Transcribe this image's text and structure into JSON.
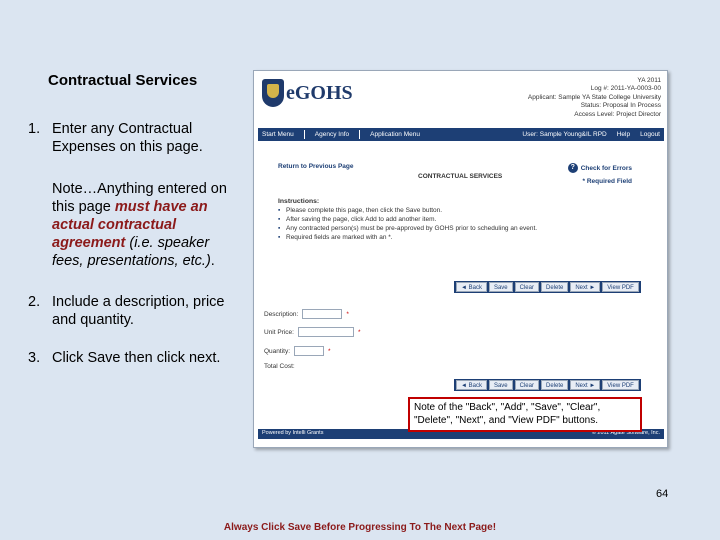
{
  "title": "Contractual Services",
  "steps": [
    {
      "num": "1.",
      "text": "Enter any Contractual Expenses on this page."
    },
    {
      "num": "2.",
      "text": "Include a description, price and quantity."
    },
    {
      "num": "3.",
      "text": "Click Save then click next."
    }
  ],
  "note": {
    "prefix": "Note…Anything entered on this page ",
    "emphasis": "must have an actual contractual agreement",
    "suffix_italic": " (i.e. speaker fees, presentations, etc.)",
    "end": "."
  },
  "screenshot": {
    "logo": "eGOHS",
    "user_info": [
      "YA 2011",
      "Log #: 2011-YA-0003-00",
      "Applicant: Sample YA State College University",
      "Status: Proposal In Process",
      "Access Level: Project Director"
    ],
    "nav": {
      "start_menu": "Start Menu",
      "agency_info": "Agency Info",
      "application_menu": "Application Menu",
      "user": "User: Sample Young&IL RPD",
      "help": "Help",
      "logout": "Logout"
    },
    "back_link": "Return to Previous Page",
    "page_heading": "CONTRACTUAL SERVICES",
    "check_errors": "Check for Errors",
    "required_field": "* Required Field",
    "instructions_title": "Instructions:",
    "instructions": [
      "Please complete this page, then click the Save button.",
      "After saving the page, click Add to add another item.",
      "Any contracted person(s) must be pre-approved by GOHS prior to scheduling an event.",
      "Required fields are marked with an *."
    ],
    "toolbar": [
      "◄ Back",
      "Save",
      "Clear",
      "Delete",
      "Next ►",
      "View PDF"
    ],
    "form": {
      "description": "Description:",
      "unit_price": "Unit Price:",
      "quantity": "Quantity:",
      "total_cost": "Total Cost:"
    },
    "footer_left": "Powered by Intelli Grants",
    "footer_right": "© 2011 Agate Software, Inc."
  },
  "callout": "Note of the \"Back\", \"Add\", \"Save\", \"Clear\", \"Delete\", \"Next\", and \"View PDF\" buttons.",
  "page_number": "64",
  "bottom_note": "Always Click Save Before Progressing To The Next Page!"
}
